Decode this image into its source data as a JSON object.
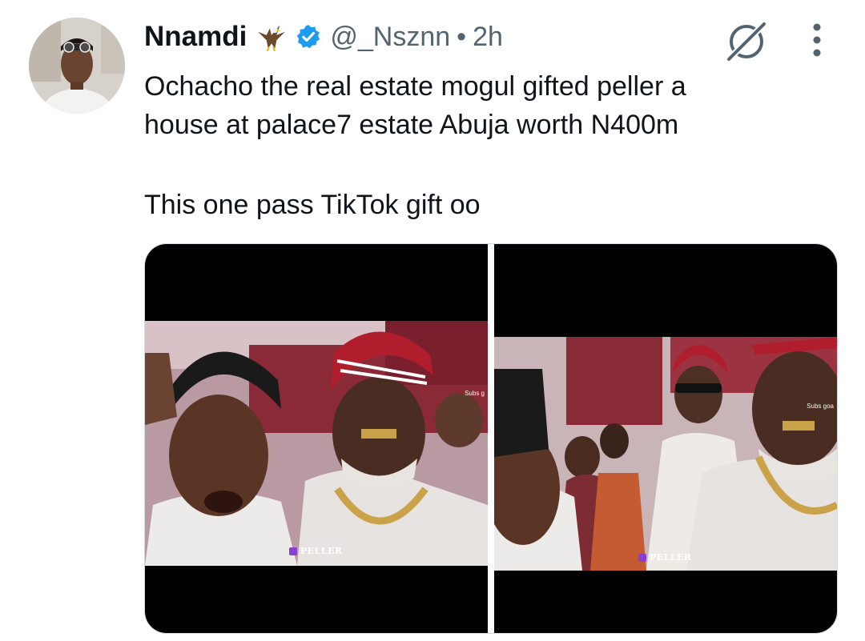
{
  "tweet": {
    "author": {
      "name": "Nnamdi",
      "handle": "@_Nsznn",
      "verified": true,
      "badge_emoji": "eagle"
    },
    "separator": "•",
    "time": "2h",
    "text_lines": [
      "Ochacho the real estate mogul gifted peller a",
      "house at palace7 estate Abuja worth N400m",
      "",
      "This one pass TikTok gift oo"
    ],
    "media": [
      {
        "watermark": "PELLER",
        "overlay": "Subs g"
      },
      {
        "watermark": "PELLER",
        "overlay": "Subs goa"
      }
    ]
  },
  "icons": {
    "verified": "verified-badge-icon",
    "grok": "grok-icon",
    "more": "more-options-icon"
  },
  "colors": {
    "name": "#0f1419",
    "secondary": "#536471",
    "verified_blue": "#1d9bf0",
    "media_border": "#cfd9de",
    "watermark_purple": "#8a3fd1"
  }
}
